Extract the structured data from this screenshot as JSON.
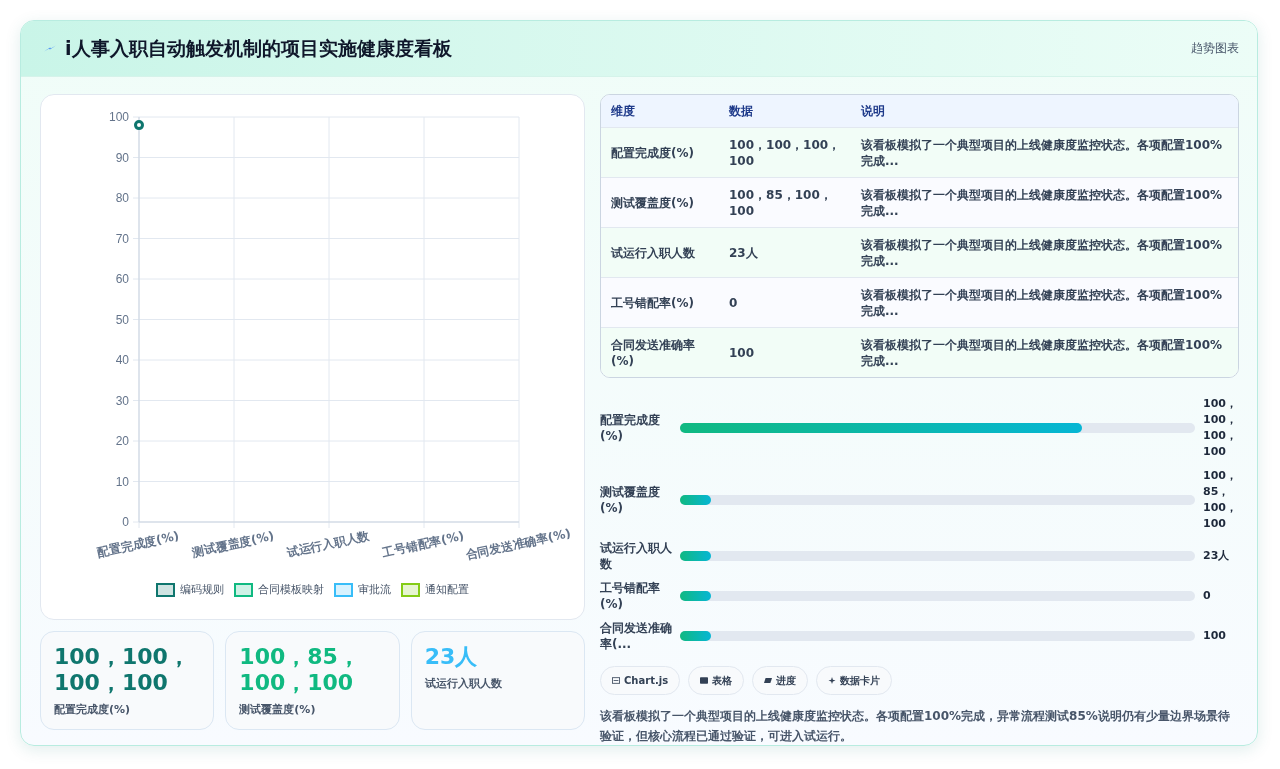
{
  "header": {
    "title": "i人事入职自动触发机制的项目实施健康度看板",
    "link": "趋势图表"
  },
  "chart": {
    "chart_data": {
      "type": "line",
      "categories": [
        "配置完成度(%)",
        "测试覆盖度(%)",
        "试运行入职人数",
        "工号错配率(%)",
        "合同发送准确率(%)"
      ],
      "ylim": [
        0,
        100
      ],
      "grid": true,
      "yticks": [
        0,
        10,
        20,
        30,
        40,
        50,
        60,
        70,
        80,
        90,
        100
      ],
      "series": [
        {
          "name": "编码规则",
          "color": "#0f766e",
          "marker": "circle",
          "values": [
            98,
            null,
            null,
            null,
            null
          ]
        },
        {
          "name": "合同模板映射",
          "color": "#10b981",
          "values": [
            null,
            null,
            null,
            null,
            null
          ]
        },
        {
          "name": "审批流",
          "color": "#38bdf8",
          "values": [
            null,
            null,
            null,
            null,
            null
          ]
        },
        {
          "name": "通知配置",
          "color": "#84cc16",
          "values": [
            null,
            null,
            null,
            null,
            null
          ]
        }
      ]
    }
  },
  "stat_cards": [
    {
      "value": "100，100，100，100",
      "label": "配置完成度(%)",
      "color": "#0f766e"
    },
    {
      "value": "100，85，100，100",
      "label": "测试覆盖度(%)",
      "color": "#10b981"
    },
    {
      "value": "23人",
      "label": "试运行入职人数",
      "color": "#38bdf8"
    }
  ],
  "table": {
    "columns": [
      "维度",
      "数据",
      "说明"
    ],
    "rows": [
      [
        "配置完成度(%)",
        "100，100，100，100",
        "该看板模拟了一个典型项目的上线健康度监控状态。各项配置100%完成..."
      ],
      [
        "测试覆盖度(%)",
        "100，85，100，100",
        "该看板模拟了一个典型项目的上线健康度监控状态。各项配置100%完成..."
      ],
      [
        "试运行入职人数",
        "23人",
        "该看板模拟了一个典型项目的上线健康度监控状态。各项配置100%完成..."
      ],
      [
        "工号错配率(%)",
        "0",
        "该看板模拟了一个典型项目的上线健康度监控状态。各项配置100%完成..."
      ],
      [
        "合同发送准确率(%)",
        "100",
        "该看板模拟了一个典型项目的上线健康度监控状态。各项配置100%完成..."
      ]
    ]
  },
  "progress": [
    {
      "label": "配置完成度(%)",
      "level": 0.78,
      "value": "100，100，100，100"
    },
    {
      "label": "测试覆盖度(%)",
      "level": 0.06,
      "value": "100，85，100，100"
    },
    {
      "label": "试运行入职人数",
      "level": 0.06,
      "value": "23人"
    },
    {
      "label": "工号错配率(%)",
      "level": 0.06,
      "value": "0"
    },
    {
      "label": "合同发送准确率(...",
      "level": 0.06,
      "value": "100"
    }
  ],
  "view_chips": [
    {
      "kind": "chart",
      "label": "Chart.js"
    },
    {
      "kind": "table",
      "label": "表格"
    },
    {
      "kind": "progress",
      "label": "进度"
    },
    {
      "kind": "cards",
      "label": "数据卡片"
    }
  ],
  "summary": "该看板模拟了一个典型项目的上线健康度监控状态。各项配置100%完成，异常流程测试85%说明仍有少量边界场景待验证，但核心流程已通过验证，可进入试运行。"
}
